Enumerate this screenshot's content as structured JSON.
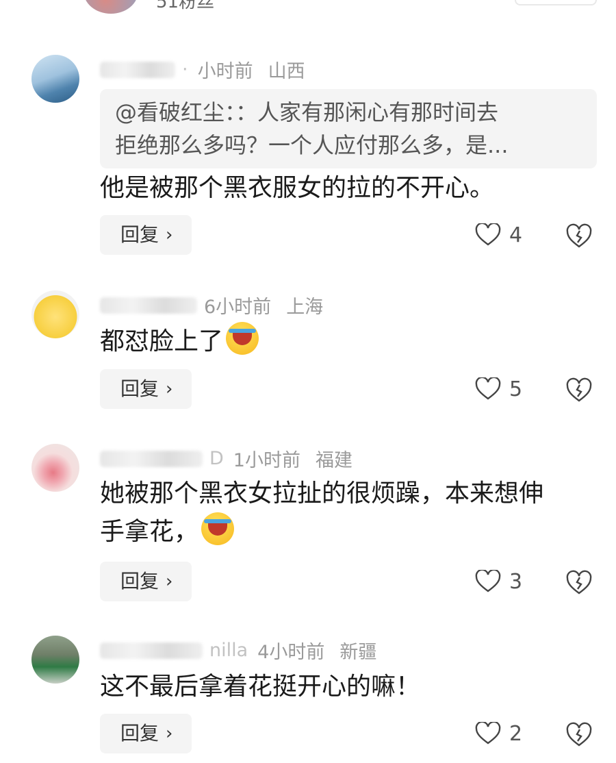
{
  "top": {
    "fans": "51粉丝"
  },
  "comments": [
    {
      "name_partial": "·",
      "time": "小时前",
      "location": "山西",
      "quote_line1": "@看破红尘：：人家有那闲心有那时间去",
      "quote_line2": "拒绝那么多吗？一个人应付那么多，是...",
      "text": "他是被那个黑衣服女的拉的不开心。",
      "reply": "回复",
      "likes": "4"
    },
    {
      "name_partial": "",
      "time": "6小时前",
      "location": "上海",
      "text": "都怼脸上了",
      "reply": "回复",
      "likes": "5"
    },
    {
      "name_partial": "D",
      "time": "1小时前",
      "location": "福建",
      "text_line1": "她被那个黑衣女拉扯的很烦躁，本来想伸",
      "text_line2": "手拿花，",
      "reply": "回复",
      "likes": "3"
    },
    {
      "name_partial": "nilla",
      "time": "4小时前",
      "location": "新疆",
      "text": "这不最后拿着花挺开心的嘛！",
      "reply": "回复",
      "likes": "2"
    }
  ],
  "icons": {
    "like": "heart-outline-icon",
    "dislike": "broken-heart-icon",
    "reply_arrow": "chevron-right-icon"
  }
}
